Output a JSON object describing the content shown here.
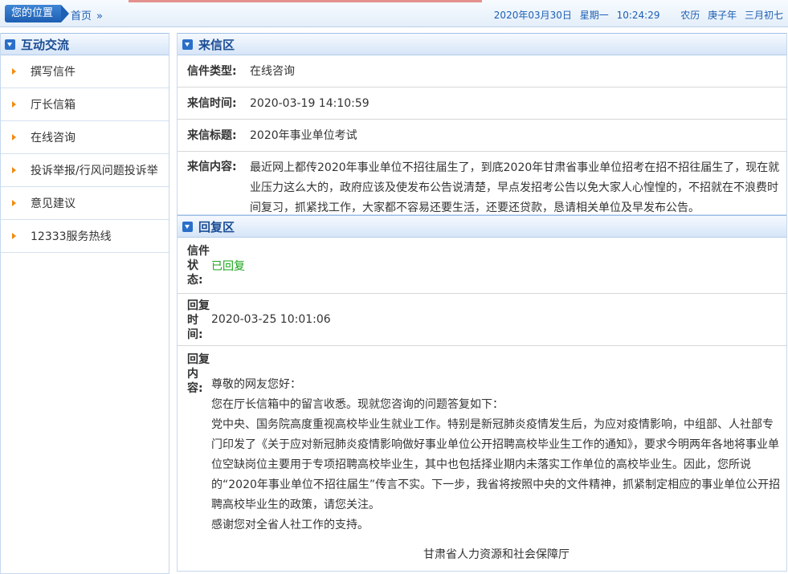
{
  "topbar": {
    "location_label": "您的位置",
    "breadcrumb_home": "首页",
    "breadcrumb_sep": "»",
    "date": "2020年03月30日",
    "weekday": "星期一",
    "time": "10:24:29",
    "lunar_label": "农历",
    "lunar_year": "庚子年",
    "lunar_day": "三月初七"
  },
  "sidebar": {
    "title": "互动交流",
    "items": [
      {
        "label": "撰写信件"
      },
      {
        "label": "厅长信箱"
      },
      {
        "label": "在线咨询"
      },
      {
        "label": "投诉举报/行风问题投诉举"
      },
      {
        "label": "意见建议"
      },
      {
        "label": "12333服务热线"
      }
    ]
  },
  "letter": {
    "title": "来信区",
    "type_label": "信件类型:",
    "type_value": "在线咨询",
    "time_label": "来信时间:",
    "time_value": "2020-03-19 14:10:59",
    "subject_label": "来信标题:",
    "subject_value": "2020年事业单位考试",
    "content_label": "来信内容:",
    "content_value": "最近网上都传2020年事业单位不招往届生了，到底2020年甘肃省事业单位招考在招不招往届生了，现在就业压力这么大的，政府应该及使发布公告说清楚，早点发招考公告以免大家人心惶惶的，不招就在不浪费时间复习，抓紧找工作，大家都不容易还要生活，还要还贷款，恳请相关单位及早发布公告。"
  },
  "reply": {
    "title": "回复区",
    "status_label": "信件状态:",
    "status_value": "已回复",
    "status_color": "#1aa31a",
    "time_label": "回复时间:",
    "time_value": "2020-03-25 10:01:06",
    "content_label": "回复内容:",
    "greeting": "尊敬的网友您好：",
    "line1": "您在厅长信箱中的留言收悉。现就您咨询的问题答复如下：",
    "line2": "党中央、国务院高度重视高校毕业生就业工作。特别是新冠肺炎疫情发生后，为应对疫情影响，中组部、人社部专门印发了《关于应对新冠肺炎疫情影响做好事业单位公开招聘高校毕业生工作的通知》，要求今明两年各地将事业单位空缺岗位主要用于专项招聘高校毕业生，其中也包括择业期内未落实工作单位的高校毕业生。因此，您所说的“2020年事业单位不招往届生”传言不实。下一步，我省将按照中央的文件精神，抓紧制定相应的事业单位公开招聘高校毕业生的政策，请您关注。",
    "line3": "感谢您对全省人社工作的支持。",
    "signature": "甘肃省人力资源和社会保障厅"
  }
}
